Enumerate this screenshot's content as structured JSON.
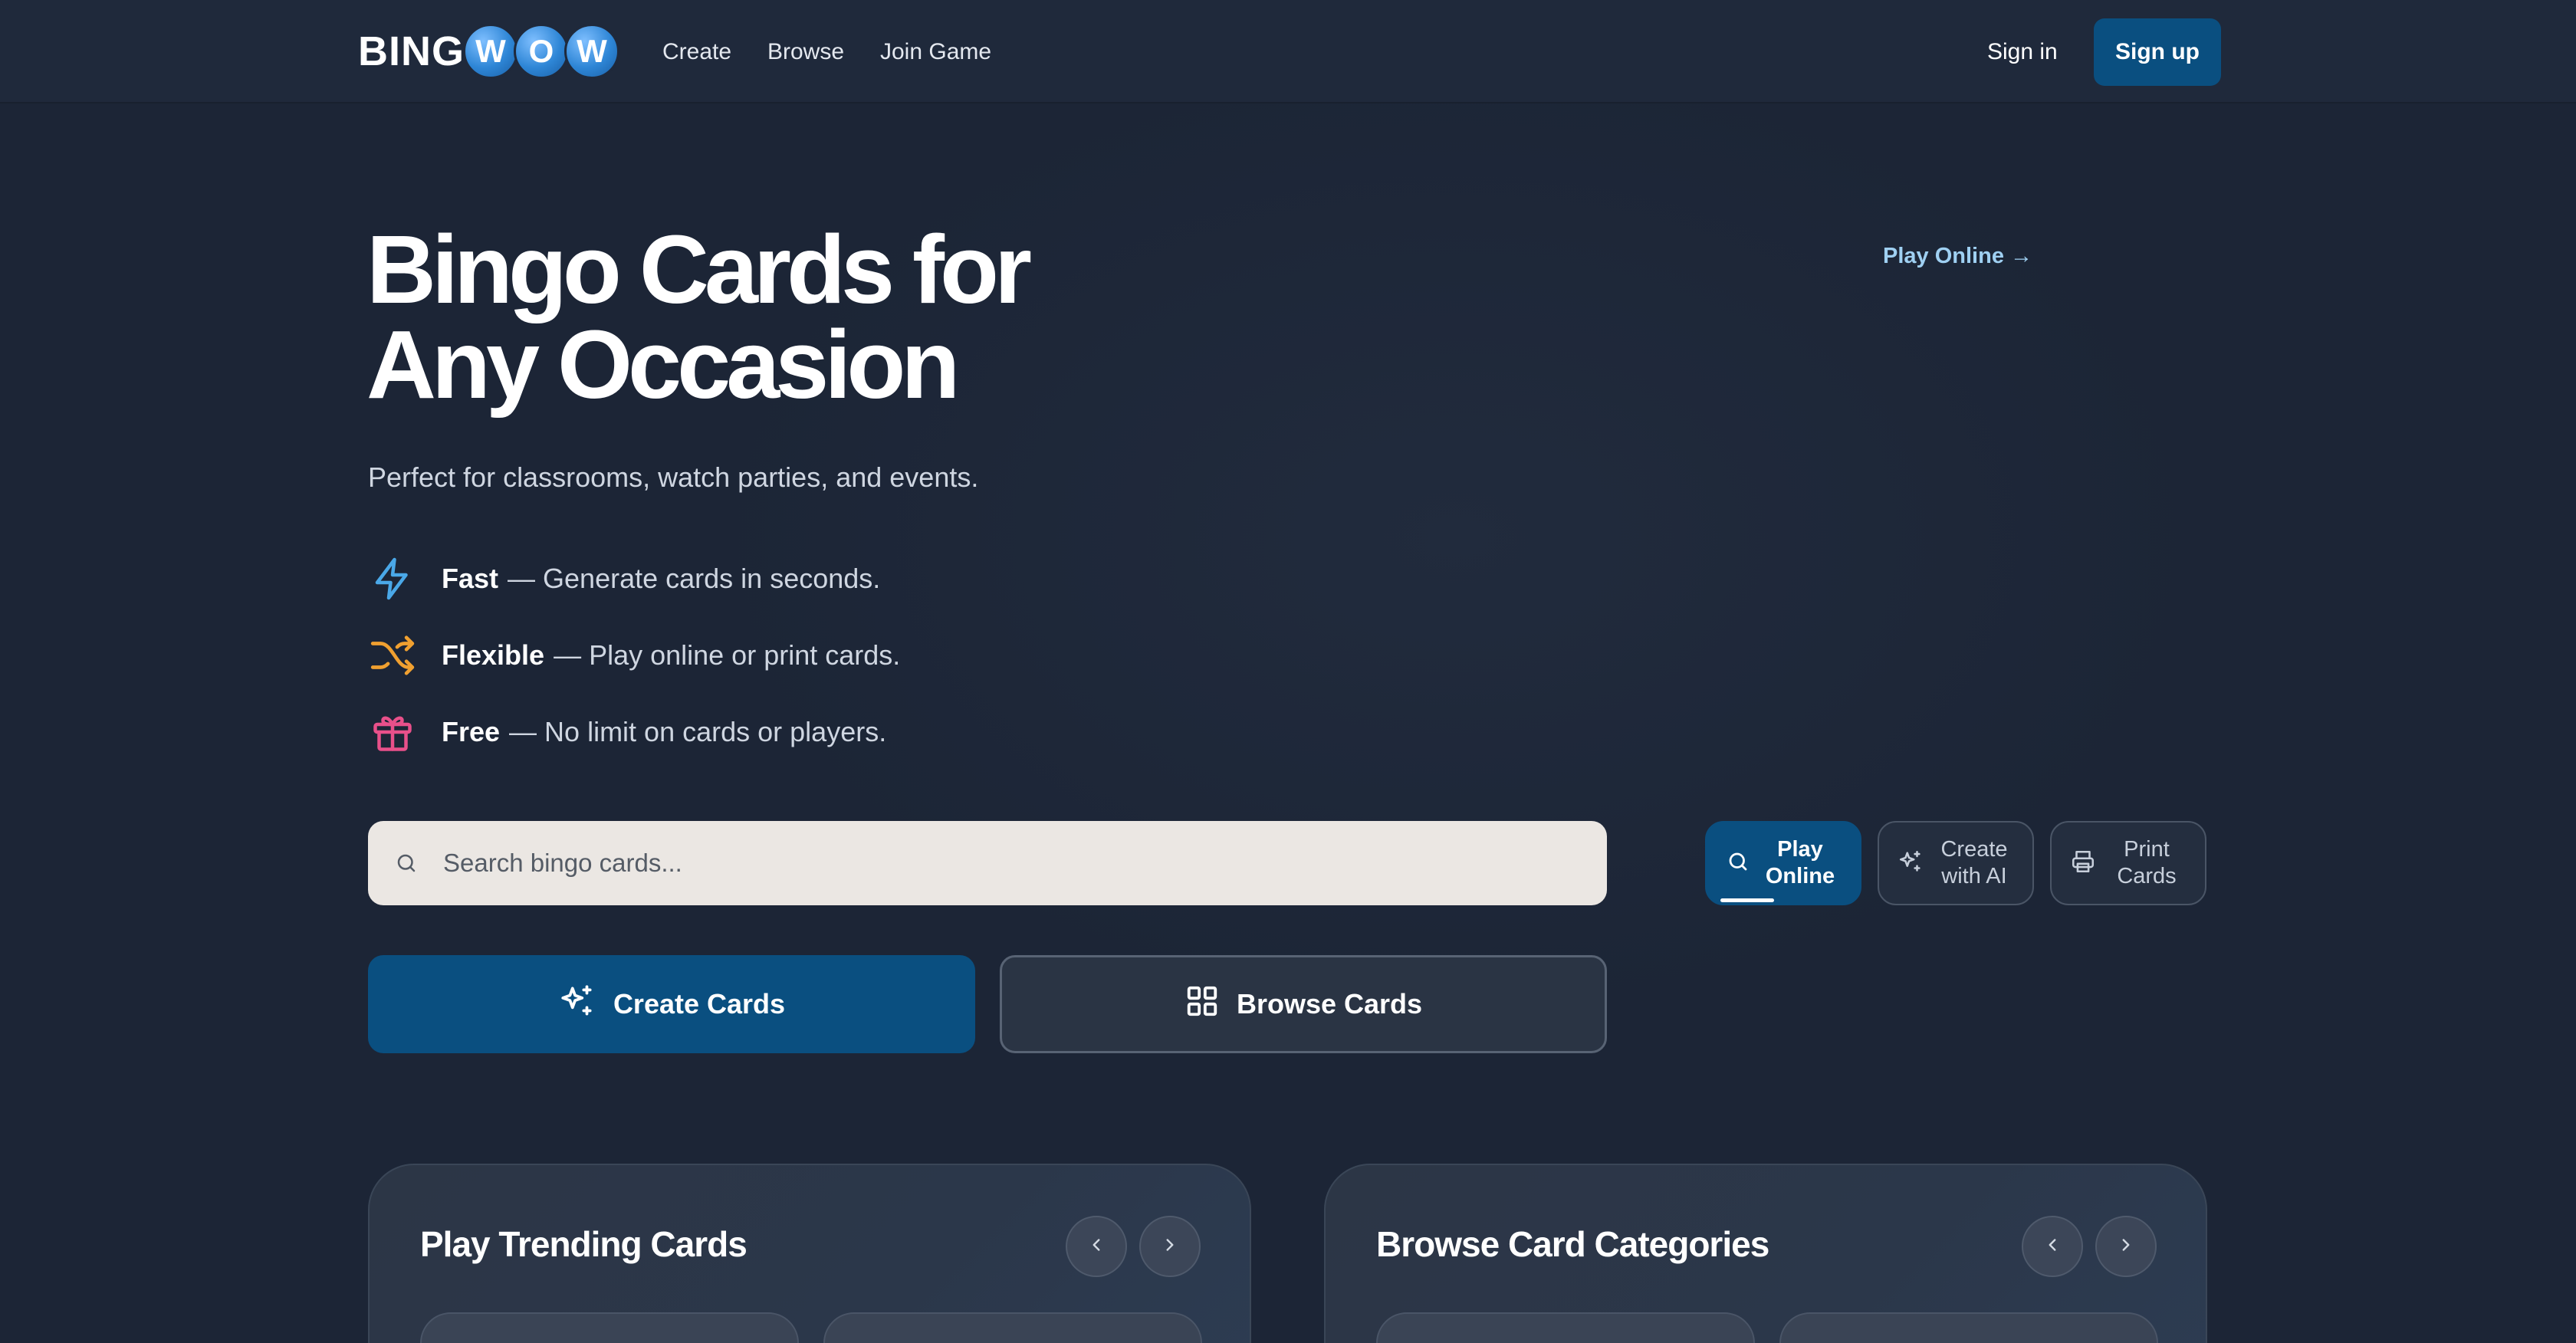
{
  "header": {
    "logo": {
      "text": "BING",
      "balls": [
        "W",
        "O",
        "W"
      ]
    },
    "nav": [
      "Create",
      "Browse",
      "Join Game"
    ],
    "sign_in": "Sign in",
    "sign_up": "Sign up"
  },
  "hero": {
    "title_line1": "Bingo Cards for",
    "title_line2": "Any Occasion",
    "subtitle": "Perfect for classrooms, watch parties, and events.",
    "play_online_link": "Play Online →",
    "features": [
      {
        "icon": "lightning-icon",
        "name": "Fast",
        "desc": "— Generate cards in seconds.",
        "color": "#4aa8e8"
      },
      {
        "icon": "shuffle-icon",
        "name": "Flexible",
        "desc": "— Play online or print cards.",
        "color": "#f0a030"
      },
      {
        "icon": "gift-icon",
        "name": "Free",
        "desc": "— No limit on cards or players.",
        "color": "#e8508a"
      }
    ]
  },
  "search": {
    "placeholder": "Search bingo cards..."
  },
  "modes": [
    {
      "label": "Play Online",
      "icon": "search-icon",
      "selected": true
    },
    {
      "label": "Create with AI",
      "icon": "sparkles-icon",
      "selected": false
    },
    {
      "label": "Print Cards",
      "icon": "printer-icon",
      "selected": false
    }
  ],
  "actions": {
    "create": "Create Cards",
    "browse": "Browse Cards"
  },
  "panels": {
    "trending": "Play Trending Cards",
    "categories": "Browse Card Categories"
  },
  "colors": {
    "background": "#1c2536",
    "primary": "#0a4f80",
    "search_bg": "#ebe7e3"
  }
}
